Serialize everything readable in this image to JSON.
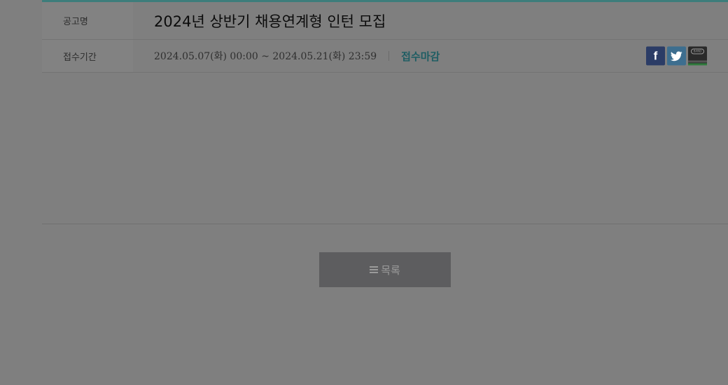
{
  "notice": {
    "title_label": "공고명",
    "title": "2024년 상반기 채용연계형 인턴 모집",
    "period_label": "접수기간",
    "period": "2024.05.07(화) 00:00 ~ 2024.05.21(화) 23:59",
    "status": "접수마감"
  },
  "share": {
    "facebook_icon": "f",
    "band_label": "BAND"
  },
  "actions": {
    "list_button_label": "목록"
  },
  "colors": {
    "accent": "#3d7d7b",
    "status": "#1e5d63",
    "facebook": "#2b3c66",
    "twitter": "#3d6e8f"
  }
}
